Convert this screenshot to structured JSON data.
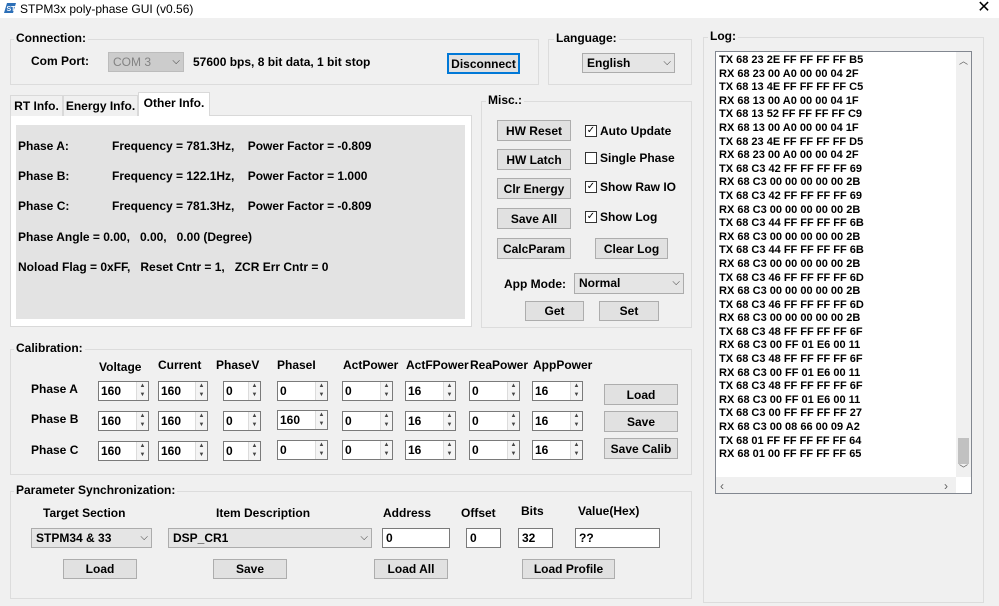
{
  "window": {
    "title": "STPM3x poly-phase GUI (v0.56)",
    "close_glyph": "✕",
    "icon": "st-logo-icon"
  },
  "connection": {
    "group_label": "Connection:",
    "com_port_label": "Com Port:",
    "com_port_value": "COM 3",
    "settings_text": "57600 bps, 8 bit data, 1 bit stop",
    "disconnect_label": "Disconnect"
  },
  "language": {
    "group_label": "Language:",
    "value": "English"
  },
  "tabs": [
    {
      "label": "RT Info.",
      "active": false
    },
    {
      "label": "Energy Info.",
      "active": false
    },
    {
      "label": "Other Info.",
      "active": true
    }
  ],
  "other_info": {
    "phase_a_label": "Phase A:",
    "phase_a_values": "Frequency = 781.3Hz,    Power Factor = -0.809",
    "phase_b_label": "Phase B:",
    "phase_b_values": "Frequency = 122.1Hz,    Power Factor = 1.000",
    "phase_c_label": "Phase C:",
    "phase_c_values": "Frequency = 781.3Hz,    Power Factor = -0.809",
    "phase_angle": "Phase Angle = 0.00,   0.00,   0.00 (Degree)",
    "noload": "Noload Flag = 0xFF,   Reset Cntr = 1,   ZCR Err Cntr = 0"
  },
  "misc": {
    "group_label": "Misc.:",
    "hw_reset": "HW Reset",
    "hw_latch": "HW Latch",
    "clr_energy": "Clr Energy",
    "save_all": "Save All",
    "calc_param": "CalcParam",
    "clear_log": "Clear Log",
    "auto_update": {
      "label": "Auto Update",
      "checked": true
    },
    "single_phase": {
      "label": "Single Phase",
      "checked": false
    },
    "show_raw_io": {
      "label": "Show Raw IO",
      "checked": true
    },
    "show_log": {
      "label": "Show Log",
      "checked": true
    },
    "app_mode_label": "App Mode:",
    "app_mode_value": "Normal",
    "get": "Get",
    "set": "Set",
    "check_glyph": "✓"
  },
  "calibration": {
    "group_label": "Calibration:",
    "columns": [
      "Voltage",
      "Current",
      "PhaseV",
      "PhaseI",
      "ActPower",
      "ActFPower",
      "ReaPower",
      "AppPower"
    ],
    "rows": [
      {
        "label": "Phase A",
        "values": [
          "160",
          "160",
          "0",
          "0",
          "0",
          "16",
          "0",
          "16"
        ]
      },
      {
        "label": "Phase B",
        "values": [
          "160",
          "160",
          "0",
          "160",
          "0",
          "16",
          "0",
          "16"
        ]
      },
      {
        "label": "Phase C",
        "values": [
          "160",
          "160",
          "0",
          "0",
          "0",
          "16",
          "0",
          "16"
        ]
      }
    ],
    "load": "Load",
    "save": "Save",
    "save_calib": "Save Calib"
  },
  "param_sync": {
    "group_label": "Parameter Synchronization:",
    "target_section_label": "Target Section",
    "item_description_label": "Item Description",
    "address_label": "Address",
    "offset_label": "Offset",
    "bits_label": "Bits",
    "value_label": "Value(Hex)",
    "target_section_value": "STPM34 & 33",
    "item_description_value": "DSP_CR1",
    "address_value": "0",
    "offset_value": "0",
    "bits_value": "32",
    "value_value": "??",
    "load": "Load",
    "save": "Save",
    "load_all": "Load All",
    "load_profile": "Load Profile"
  },
  "log": {
    "group_label": "Log:",
    "lines": [
      "TX 68 23 2E FF FF FF FF B5",
      "RX 68 23 00 A0 00 00 04 2F",
      "TX 68 13 4E FF FF FF FF C5",
      "RX 68 13 00 A0 00 00 04 1F",
      "TX 68 13 52 FF FF FF FF C9",
      "RX 68 13 00 A0 00 00 04 1F",
      "TX 68 23 4E FF FF FF FF D5",
      "RX 68 23 00 A0 00 00 04 2F",
      "TX 68 C3 42 FF FF FF FF 69",
      "RX 68 C3 00 00 00 00 00 2B",
      "TX 68 C3 42 FF FF FF FF 69",
      "RX 68 C3 00 00 00 00 00 2B",
      "TX 68 C3 44 FF FF FF FF 6B",
      "RX 68 C3 00 00 00 00 00 2B",
      "TX 68 C3 44 FF FF FF FF 6B",
      "RX 68 C3 00 00 00 00 00 2B",
      "TX 68 C3 46 FF FF FF FF 6D",
      "RX 68 C3 00 00 00 00 00 2B",
      "TX 68 C3 46 FF FF FF FF 6D",
      "RX 68 C3 00 00 00 00 00 2B",
      "TX 68 C3 48 FF FF FF FF 6F",
      "RX 68 C3 00 FF 01 E6 00 11",
      "TX 68 C3 48 FF FF FF FF 6F",
      "RX 68 C3 00 FF 01 E6 00 11",
      "TX 68 C3 48 FF FF FF FF 6F",
      "RX 68 C3 00 FF 01 E6 00 11",
      "TX 68 C3 00 FF FF FF FF 27",
      "RX 68 C3 00 08 66 00 09 A2",
      "TX 68 01 FF FF FF FF FF 64",
      "RX 68 01 00 FF FF FF FF 65"
    ]
  },
  "glyphs": {
    "combo_arrow": "⌵",
    "spin_up": "▲",
    "spin_down": "▼",
    "scroll_up": "︿",
    "scroll_down": "﹀",
    "scroll_left": "‹",
    "scroll_right": "›"
  }
}
